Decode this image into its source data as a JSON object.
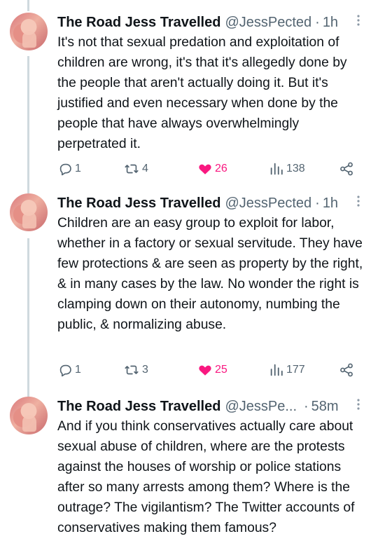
{
  "tweets": [
    {
      "name": "The Road Jess Travelled",
      "handle": "@JessPected",
      "separator": "·",
      "time": "1h",
      "text": "It's not that sexual predation and exploitation of children are wrong, it's that it's allegedly done by the people that aren't actually doing it. But it's justified and even necessary when done by the people that have always overwhelmingly perpetrated it.",
      "replies": "1",
      "retweets": "4",
      "likes": "26",
      "views": "138"
    },
    {
      "name": "The Road Jess Travelled",
      "handle": "@JessPected",
      "separator": "·",
      "time": "1h",
      "text": "Children are an easy group to exploit for labor, whether in a factory or sexual servitude. They have few protections & are seen as property by the right, & in many cases by the law. No wonder the right is clamping down on their autonomy, numbing the public, & normalizing abuse.",
      "replies": "1",
      "retweets": "3",
      "likes": "25",
      "views": "177"
    },
    {
      "name": "The Road Jess Travelled",
      "handle": "@JessPe...",
      "separator": "·",
      "time": "58m",
      "text": "And if you think conservatives actually care about sexual abuse of children, where are the protests against the houses of worship or police stations after so many arrests among them? Where is the outrage? The vigilantism? The Twitter accounts of conservatives making them famous?"
    }
  ],
  "icons": {
    "more": "more-vertical-icon",
    "reply": "reply-icon",
    "retweet": "retweet-icon",
    "like": "heart-filled-icon",
    "views": "views-chart-icon",
    "share": "share-icon"
  },
  "colors": {
    "like_active": "#f91880",
    "secondary_text": "#536471",
    "thread_line": "#cfd9de"
  }
}
